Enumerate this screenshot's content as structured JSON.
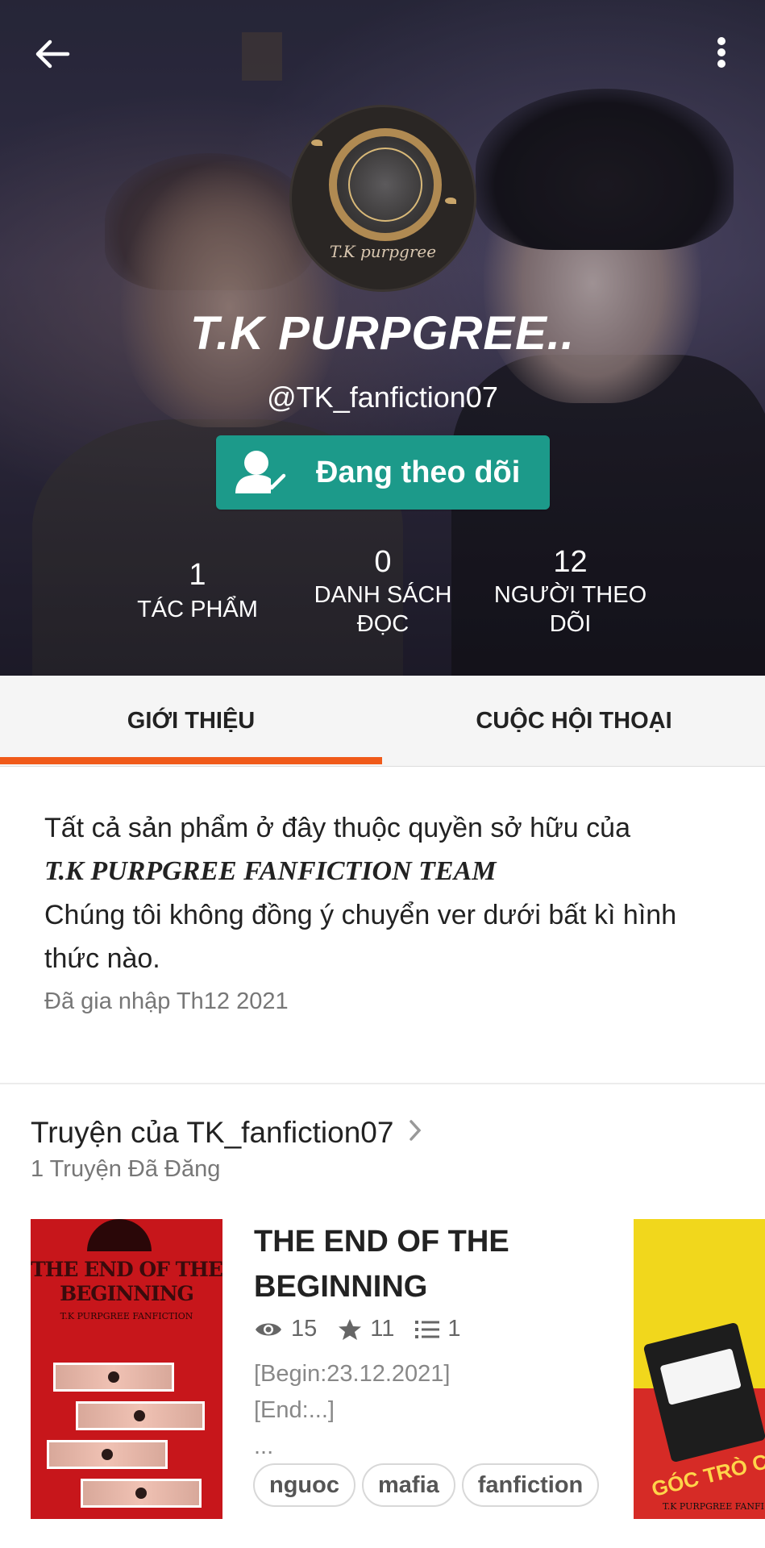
{
  "header": {
    "username": "T.K PURPGREE..",
    "handle": "@TK_fanfiction07",
    "follow_label": "Đang theo dõi",
    "avatar_text": "T.K purpgree",
    "stats": [
      {
        "value": "1",
        "label": "TÁC PHẨM"
      },
      {
        "value": "0",
        "label_line1": "DANH SÁCH",
        "label_line2": "ĐỌC"
      },
      {
        "value": "12",
        "label_line1": "NGƯỜI THEO",
        "label_line2": "DÕI"
      }
    ]
  },
  "tabs": [
    {
      "label": "GIỚI THIỆU",
      "active": true
    },
    {
      "label": "CUỘC HỘI THOẠI",
      "active": false
    }
  ],
  "about": {
    "line1": "Tất cả sản phẩm ở đây thuộc quyền sở hữu của",
    "team": "T.K PURPGREE FANFICTION TEAM",
    "line2": "Chúng tôi không đồng ý chuyển ver dưới bất kì hình thức nào.",
    "joined": "Đã gia nhập Th12 2021"
  },
  "stories": {
    "title": "Truyện của TK_fanfiction07",
    "count": "1 Truyện Đã Đăng",
    "items": [
      {
        "title": "THE END OF THE BEGINNING",
        "cover_title": "THE END OF THE BEGINNING",
        "cover_sub": "T.K PURPGREE FANFICTION",
        "reads": "15",
        "votes": "11",
        "parts": "1",
        "desc1": "[Begin:23.12.2021]",
        "desc2": "[End:...]",
        "desc3": "...",
        "tags": [
          "nguoc",
          "mafia",
          "fanfiction"
        ]
      }
    ],
    "next_cover_text": "GÓC TRÒ CHUY",
    "next_cover_foot": "T.K PURPGREE FANFI"
  },
  "colors": {
    "accent": "#f05a1a",
    "follow_button": "#1c9a8a"
  }
}
